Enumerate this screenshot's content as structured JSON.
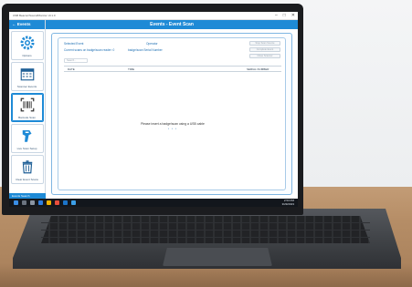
{
  "window": {
    "title": "USB Beacon/Sound/Monitor v0.1.0",
    "controls": [
      "–",
      "□",
      "✕"
    ]
  },
  "sidebar": {
    "header": "Events",
    "items": [
      {
        "label": "Options",
        "icon": "gear-icon"
      },
      {
        "label": "Scanner Events",
        "icon": "calendar-icon"
      },
      {
        "label": "Barcode Scan",
        "icon": "barcode-scan-icon"
      },
      {
        "label": "Live Scan Setup",
        "icon": "handheld-scanner-icon"
      },
      {
        "label": "Clear Event Scans",
        "icon": "trash-icon"
      }
    ],
    "footer": "Events Search"
  },
  "main": {
    "header": "Events - Event Scan",
    "scanner_event_label": "Selected Event",
    "current_scans_label": "Current scans on badge/scan reader: 0",
    "operator_label": "Operator",
    "badge_serial_label": "badge/scan Serial Number",
    "buttons": [
      "Stop Scan Source",
      "Complete Event",
      "Close Scanner"
    ],
    "field_placeholder": "Search...",
    "columns": [
      "DATE",
      "TIME",
      "SERIAL NUMBER"
    ],
    "message": "Please insert a badge/scan using a USB cable",
    "dots": "• • •"
  },
  "taskbar": {
    "tray_time": "2:53 PM",
    "tray_date": "3/29/2023"
  },
  "colors": {
    "accent": "#1e8ad6",
    "table_wood": "#b58d66"
  }
}
